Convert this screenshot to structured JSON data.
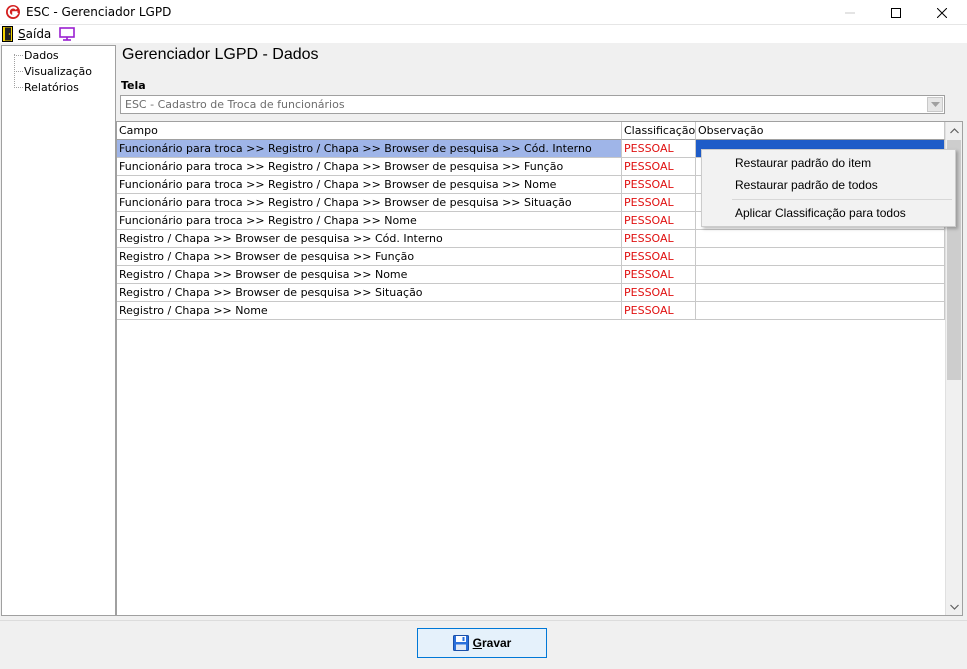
{
  "window": {
    "title": "ESC - Gerenciador LGPD",
    "icon": "app-logo-icon",
    "controls": [
      "minimize-icon",
      "maximize-icon",
      "close-icon"
    ]
  },
  "menubar": {
    "exit_label_first": "S",
    "exit_label_rest": "aída",
    "exit_icon": "exit-door-icon",
    "monitor_icon": "monitor-icon"
  },
  "sidebar": {
    "items": [
      {
        "label": "Dados"
      },
      {
        "label": "Visualização"
      },
      {
        "label": "Relatórios"
      }
    ]
  },
  "main": {
    "page_title": "Gerenciador LGPD - Dados",
    "tela_label": "Tela",
    "tela_value": "ESC - Cadastro de Troca de funcionários"
  },
  "grid": {
    "columns": [
      "Campo",
      "Classificação",
      "Observação"
    ],
    "rows": [
      {
        "campo": "Funcionário para troca >> Registro / Chapa  >> Browser de pesquisa >> Cód. Interno",
        "classificacao": "PESSOAL",
        "observacao": "",
        "selected": true
      },
      {
        "campo": "Funcionário para troca >> Registro / Chapa  >> Browser de pesquisa >> Função",
        "classificacao": "PESSOAL",
        "observacao": ""
      },
      {
        "campo": "Funcionário para troca >> Registro / Chapa  >> Browser de pesquisa >> Nome",
        "classificacao": "PESSOAL",
        "observacao": ""
      },
      {
        "campo": "Funcionário para troca >> Registro / Chapa  >> Browser de pesquisa >> Situação",
        "classificacao": "PESSOAL",
        "observacao": ""
      },
      {
        "campo": "Funcionário para troca >> Registro / Chapa >> Nome",
        "classificacao": "PESSOAL",
        "observacao": ""
      },
      {
        "campo": "Registro / Chapa >> Browser de pesquisa >> Cód. Interno",
        "classificacao": "PESSOAL",
        "observacao": ""
      },
      {
        "campo": "Registro / Chapa >> Browser de pesquisa >> Função",
        "classificacao": "PESSOAL",
        "observacao": ""
      },
      {
        "campo": "Registro / Chapa >> Browser de pesquisa >> Nome",
        "classificacao": "PESSOAL",
        "observacao": ""
      },
      {
        "campo": "Registro / Chapa >> Browser de pesquisa >> Situação",
        "classificacao": "PESSOAL",
        "observacao": ""
      },
      {
        "campo": "Registro / Chapa >> Nome",
        "classificacao": "PESSOAL",
        "observacao": ""
      }
    ]
  },
  "context_menu": {
    "items": [
      {
        "label": "Restaurar padrão do item"
      },
      {
        "label": "Restaurar padrão de todos"
      },
      {
        "label": "Aplicar Classificação para todos"
      }
    ]
  },
  "footer": {
    "save_label_first": "G",
    "save_label_rest": "ravar",
    "save_icon": "floppy-disk-icon"
  },
  "colors": {
    "classification_text": "#e01010",
    "selected_row": "#9fb5e8",
    "selected_cell": "#1e5cc8",
    "accent_border": "#0078d7"
  }
}
